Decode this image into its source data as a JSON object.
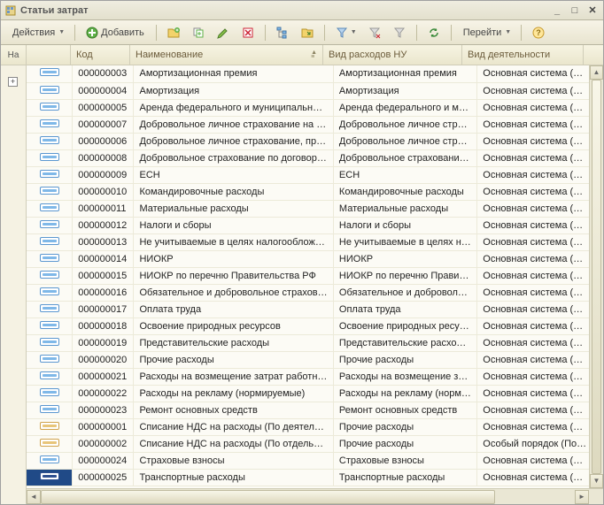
{
  "window": {
    "title": "Статьи затрат"
  },
  "toolbar": {
    "actions_label": "Действия",
    "add_label": "Добавить",
    "goto_label": "Перейти"
  },
  "columns": {
    "left_head": "На",
    "code": "Код",
    "name": "Наименование",
    "vid": "Вид расходов НУ",
    "deyat": "Вид деятельности"
  },
  "rows": [
    {
      "code": "000000003",
      "name": "Амортизационная премия",
      "vid": "Амортизационная премия",
      "deyat": "Основная система (…",
      "mark": "blue"
    },
    {
      "code": "000000004",
      "name": "Амортизация",
      "vid": "Амортизация",
      "deyat": "Основная система (…",
      "mark": "blue"
    },
    {
      "code": "000000005",
      "name": "Аренда федерального и муниципально…",
      "vid": "Аренда федерального и му…",
      "deyat": "Основная система (…",
      "mark": "blue"
    },
    {
      "code": "000000007",
      "name": "Добровольное личное страхование на …",
      "vid": "Добровольное личное стра…",
      "deyat": "Основная система (…",
      "mark": "blue"
    },
    {
      "code": "000000006",
      "name": "Добровольное личное страхование, пр…",
      "vid": "Добровольное личное стра…",
      "deyat": "Основная система (…",
      "mark": "blue"
    },
    {
      "code": "000000008",
      "name": "Добровольное страхование по договор…",
      "vid": "Добровольное страховани…",
      "deyat": "Основная система (…",
      "mark": "blue"
    },
    {
      "code": "000000009",
      "name": "ЕСН",
      "vid": "ЕСН",
      "deyat": "Основная система (…",
      "mark": "blue"
    },
    {
      "code": "000000010",
      "name": "Командировочные расходы",
      "vid": "Командировочные расходы",
      "deyat": "Основная система (…",
      "mark": "blue"
    },
    {
      "code": "000000011",
      "name": "Материальные расходы",
      "vid": "Материальные расходы",
      "deyat": "Основная система (…",
      "mark": "blue"
    },
    {
      "code": "000000012",
      "name": "Налоги и сборы",
      "vid": "Налоги и сборы",
      "deyat": "Основная система (…",
      "mark": "blue"
    },
    {
      "code": "000000013",
      "name": "Не учитываемые в целях налогооблож…",
      "vid": "Не учитываемые в целях н…",
      "deyat": "Основная система (…",
      "mark": "blue"
    },
    {
      "code": "000000014",
      "name": "НИОКР",
      "vid": "НИОКР",
      "deyat": "Основная система (…",
      "mark": "blue"
    },
    {
      "code": "000000015",
      "name": "НИОКР по перечню Правительства РФ",
      "vid": "НИОКР по перечню Правит…",
      "deyat": "Основная система (…",
      "mark": "blue"
    },
    {
      "code": "000000016",
      "name": "Обязательное и добровольное страхов…",
      "vid": "Обязательное и доброволь…",
      "deyat": "Основная система (…",
      "mark": "blue"
    },
    {
      "code": "000000017",
      "name": "Оплата труда",
      "vid": "Оплата труда",
      "deyat": "Основная система (…",
      "mark": "blue"
    },
    {
      "code": "000000018",
      "name": "Освоение природных ресурсов",
      "vid": "Освоение природных ресу…",
      "deyat": "Основная система (…",
      "mark": "blue"
    },
    {
      "code": "000000019",
      "name": "Представительские расходы",
      "vid": "Представительские расход…",
      "deyat": "Основная система (…",
      "mark": "blue"
    },
    {
      "code": "000000020",
      "name": "Прочие расходы",
      "vid": "Прочие расходы",
      "deyat": "Основная система (…",
      "mark": "blue"
    },
    {
      "code": "000000021",
      "name": "Расходы на возмещение затрат работн…",
      "vid": "Расходы на возмещение з…",
      "deyat": "Основная система (…",
      "mark": "blue"
    },
    {
      "code": "000000022",
      "name": "Расходы на рекламу (нормируемые)",
      "vid": "Расходы на рекламу (норм…",
      "deyat": "Основная система (…",
      "mark": "blue"
    },
    {
      "code": "000000023",
      "name": "Ремонт основных средств",
      "vid": "Ремонт основных средств",
      "deyat": "Основная система (…",
      "mark": "blue"
    },
    {
      "code": "000000001",
      "name": "Списание НДС на расходы (По деятель…",
      "vid": "Прочие расходы",
      "deyat": "Основная система (…",
      "mark": "gold"
    },
    {
      "code": "000000002",
      "name": "Списание НДС на расходы (По отдельн…",
      "vid": "Прочие расходы",
      "deyat": "Особый порядок (По…",
      "mark": "gold"
    },
    {
      "code": "000000024",
      "name": "Страховые взносы",
      "vid": "Страховые взносы",
      "deyat": "Основная система (…",
      "mark": "blue"
    },
    {
      "code": "000000025",
      "name": "Транспортные расходы",
      "vid": "Транспортные расходы",
      "deyat": "Основная система (…",
      "mark": "sel",
      "selected": true
    }
  ]
}
